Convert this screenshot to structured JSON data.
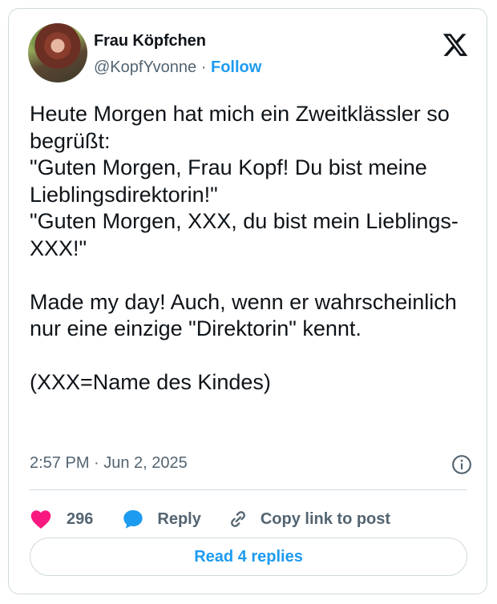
{
  "author": {
    "name": "Frau Köpfchen",
    "handle": "@KopfYvonne",
    "separator": "·",
    "follow_label": "Follow"
  },
  "tweet": {
    "text": "Heute Morgen hat mich ein Zweitklässler so begrüßt:\n\"Guten Morgen, Frau Kopf! Du bist meine Lieblingsdirektorin!\"\n\"Guten Morgen, XXX, du bist mein Lieblings-XXX!\"\n\nMade my day! Auch, wenn er wahrscheinlich nur eine einzige \"Direktorin\" kennt.\n\n(XXX=Name des Kindes)",
    "timestamp": "2:57 PM · Jun 2, 2025"
  },
  "actions": {
    "like_count": "296",
    "reply_label": "Reply",
    "copy_label": "Copy link to post"
  },
  "read_replies_label": "Read 4 replies",
  "icons": {
    "like": "heart-icon",
    "reply": "speech-bubble-icon",
    "copy": "link-icon",
    "logo": "x-logo-icon",
    "info": "info-icon"
  },
  "colors": {
    "accent": "#1d9bf0",
    "like": "#f91880",
    "secondary_text": "#536471",
    "border": "#cfd9de"
  }
}
